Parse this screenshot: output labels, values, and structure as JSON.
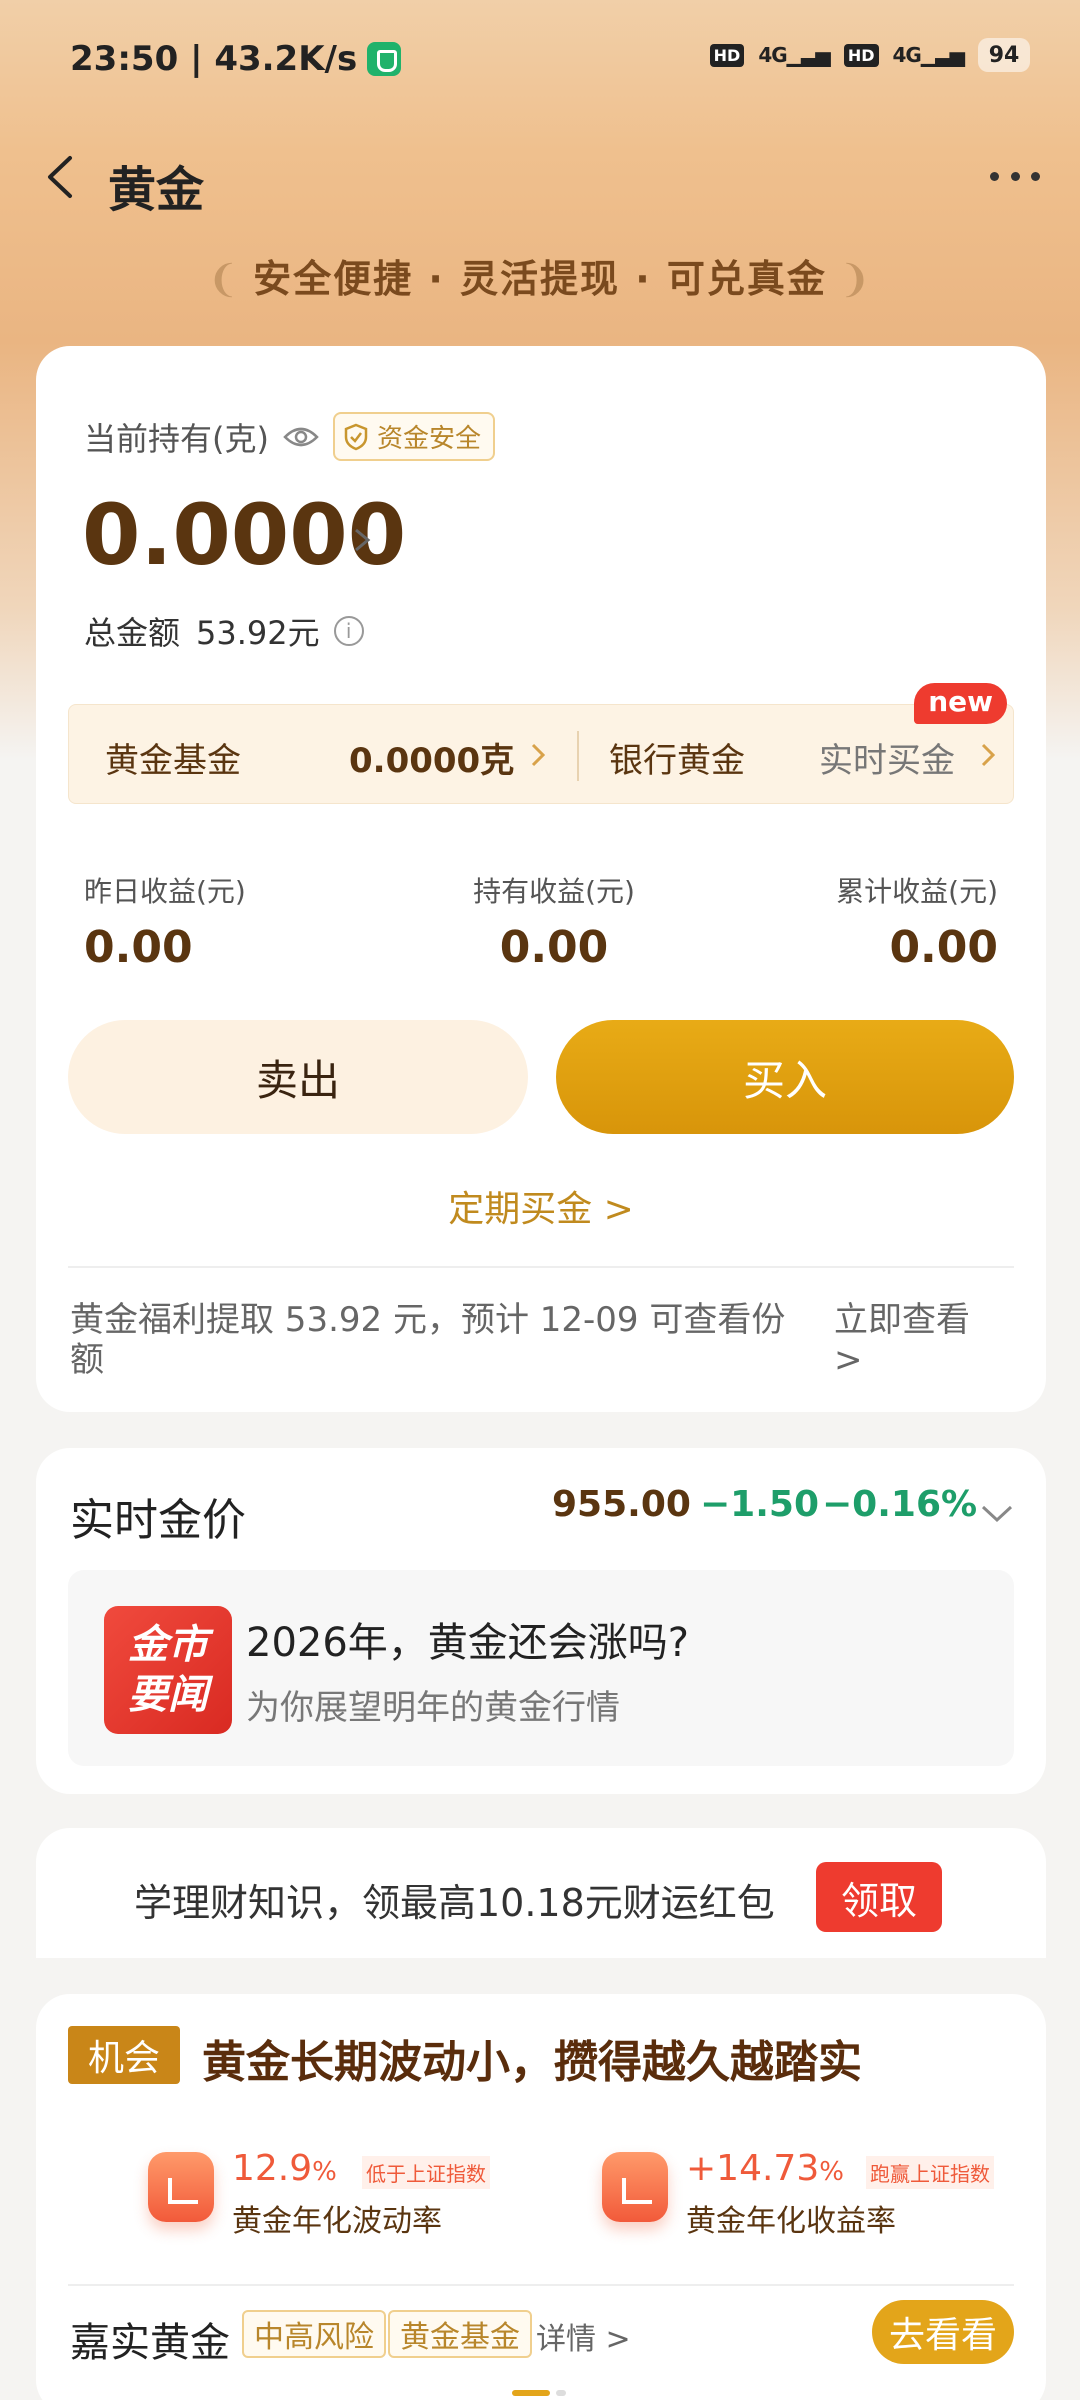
{
  "status_bar": {
    "time_speed": "23:50 | 43.2K/s",
    "battery": "94",
    "hd": "HD",
    "signal": "4G"
  },
  "nav": {
    "title": "黄金"
  },
  "slogan": "安全便捷 · 灵活提现 · 可兑真金",
  "holding": {
    "label": "当前持有(克)",
    "safe_badge": "资金安全",
    "amount": "0.0000",
    "total_label": "总金额",
    "total_value": "53.92元",
    "info_glyph": "i",
    "fund_name": "黄金基金",
    "fund_value": "0.0000克",
    "bank_name": "银行黄金",
    "buy_live": "实时买金",
    "new_badge": "new"
  },
  "earnings": {
    "yesterday_label": "昨日收益(元)",
    "yesterday_value": "0.00",
    "holding_label": "持有收益(元)",
    "holding_value": "0.00",
    "total_label": "累计收益(元)",
    "total_value": "0.00"
  },
  "actions": {
    "sell": "卖出",
    "buy": "买入",
    "regular_buy": "定期买金 >"
  },
  "notice": {
    "text": "黄金福利提取 53.92 元，预计 12-09 可查看份额",
    "link": "立即查看 >"
  },
  "price": {
    "title": "实时金价",
    "value": "955.00",
    "change": "−1.50",
    "percent": "−0.16%"
  },
  "news": {
    "logo_line1": "金市",
    "logo_line2": "要闻",
    "title": "2026年，黄金还会涨吗?",
    "subtitle": "为你展望明年的黄金行情"
  },
  "promo": {
    "text": "学理财知识，领最高10.18元财运红包",
    "button": "领取"
  },
  "opportunity": {
    "tag": "机会",
    "title": "黄金长期波动小，攒得越久越踏实",
    "vol_value": "12.9",
    "vol_unit": "%",
    "vol_tip": "低于上证指数",
    "vol_desc": "黄金年化波动率",
    "ret_value": "+14.73",
    "ret_unit": "%",
    "ret_tip": "跑赢上证指数",
    "ret_desc": "黄金年化收益率",
    "fund_name": "嘉实黄金",
    "risk_tag": "中高风险",
    "type_tag": "黄金基金",
    "detail": "详情 >",
    "go_button": "去看看"
  },
  "colors": {
    "gold_accent": "#e3a51a",
    "brown_text": "#5a3510",
    "down_green": "#1e9e6a",
    "promo_red": "#ee3b2f"
  }
}
